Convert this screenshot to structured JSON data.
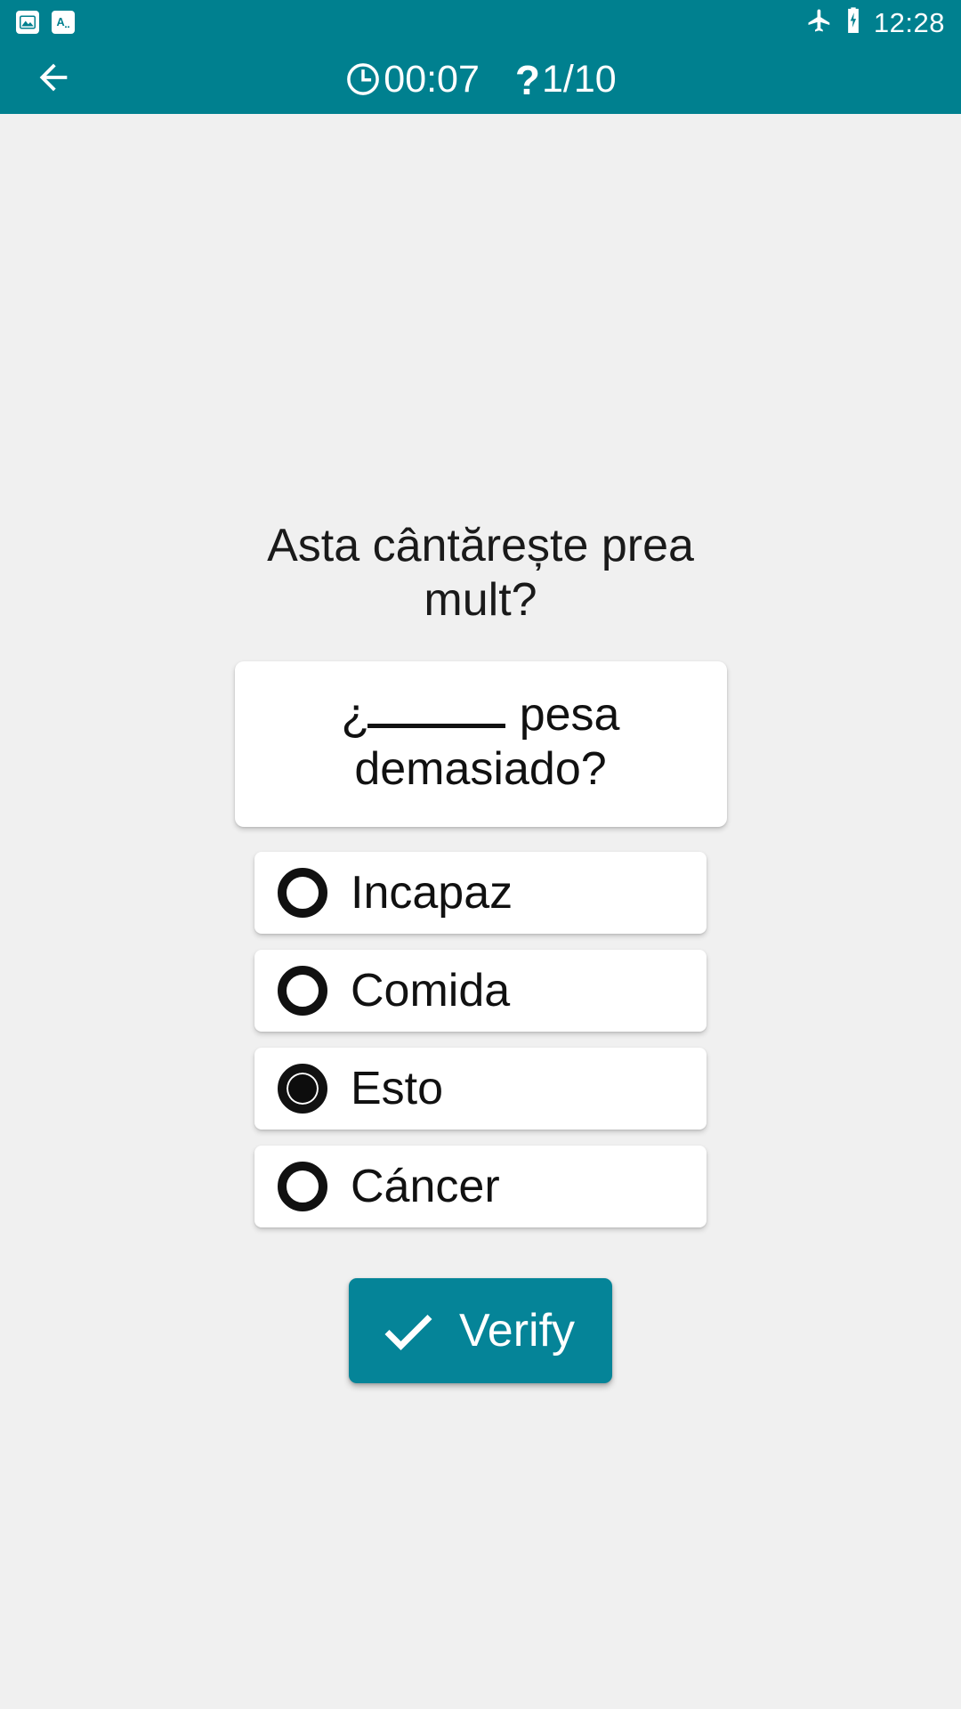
{
  "status_bar": {
    "notifications": [
      {
        "icon": "image-icon",
        "name": "image-notification"
      },
      {
        "icon": "translate-icon",
        "name": "translate-notification"
      }
    ],
    "airplane_icon": "airplane-mode-icon",
    "battery_icon": "battery-charging-icon",
    "time": "12:28"
  },
  "app_bar": {
    "back_icon": "back-arrow-icon",
    "timer_icon": "clock-icon",
    "timer_value": "00:07",
    "question_icon": "question-mark-icon",
    "question_progress": "1/10"
  },
  "quiz": {
    "prompt": "Asta cântărește prea mult?",
    "sentence_prefix": "¿",
    "sentence_blank": "_____",
    "sentence_suffix": " pesa demasiado?",
    "options": [
      {
        "label": "Incapaz",
        "selected": false
      },
      {
        "label": "Comida",
        "selected": false
      },
      {
        "label": "Esto",
        "selected": true
      },
      {
        "label": "Cáncer",
        "selected": false
      }
    ],
    "verify_label": "Verify",
    "verify_icon": "check-icon"
  },
  "colors": {
    "accent": "#00808f",
    "button": "#058498",
    "background": "#f0f0f0",
    "card": "#ffffff",
    "text": "#111111"
  }
}
